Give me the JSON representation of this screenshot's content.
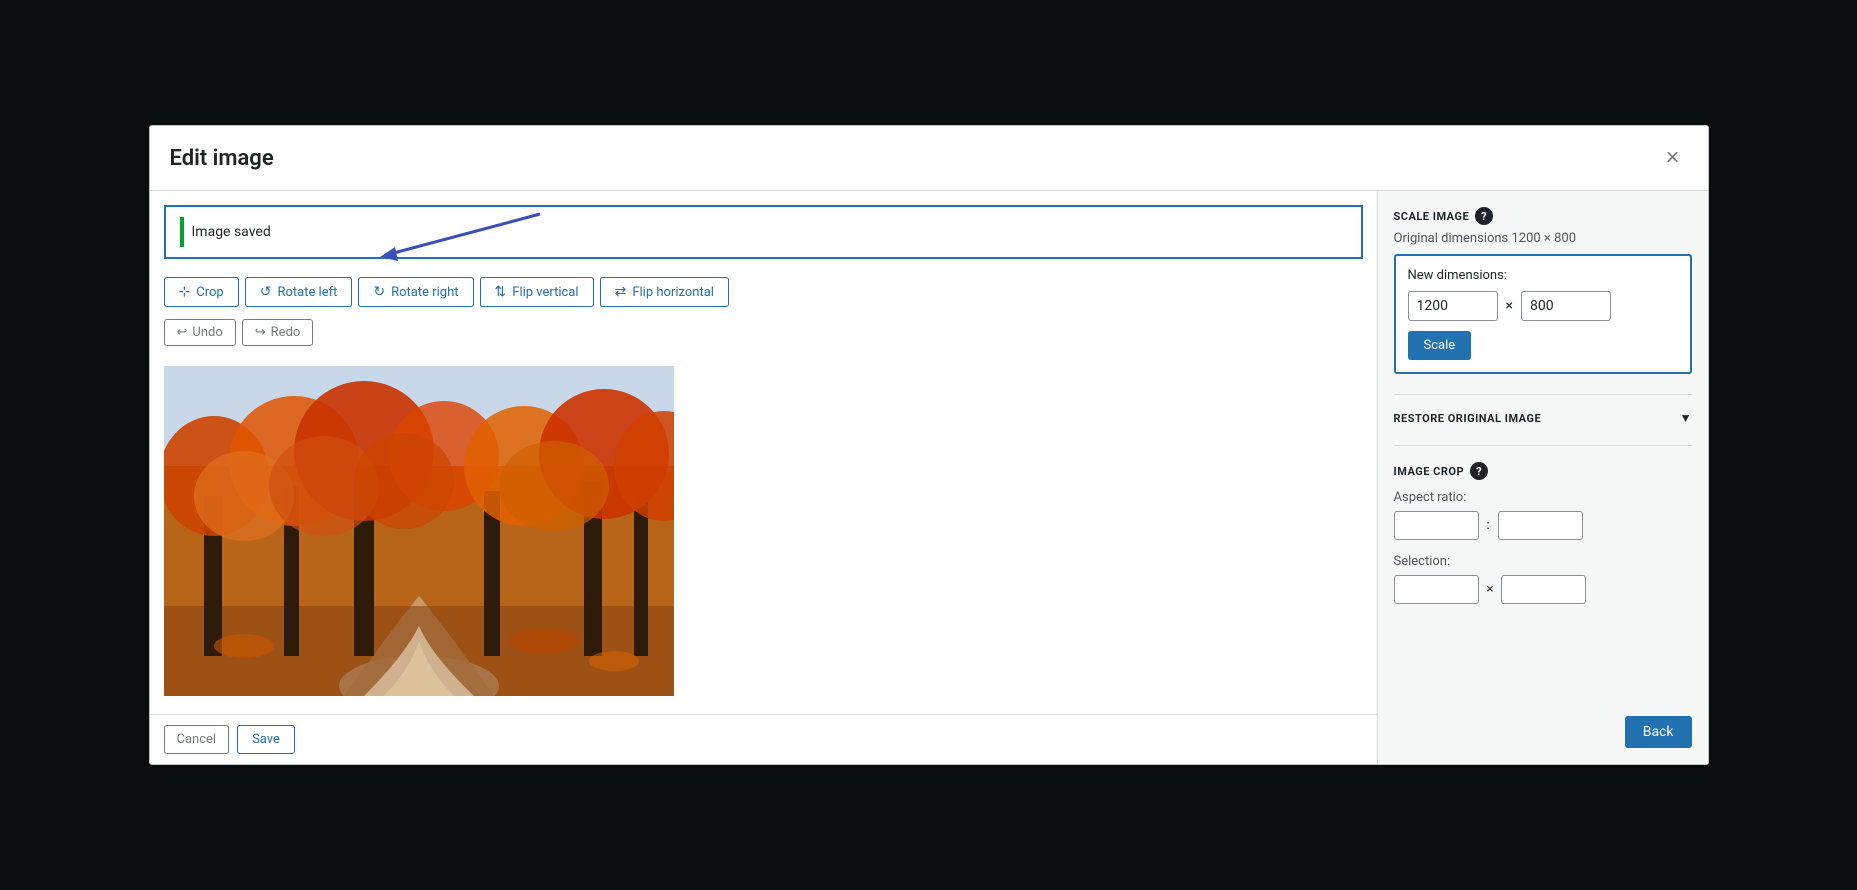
{
  "modal": {
    "title": "Edit image",
    "close_label": "×"
  },
  "notification": {
    "text": "Image saved"
  },
  "toolbar": {
    "crop_label": "Crop",
    "rotate_left_label": "Rotate left",
    "rotate_right_label": "Rotate right",
    "flip_vertical_label": "Flip vertical",
    "flip_horizontal_label": "Flip horizontal",
    "undo_label": "Undo",
    "redo_label": "Redo"
  },
  "footer": {
    "cancel_label": "Cancel",
    "save_label": "Save"
  },
  "sidebar": {
    "scale_image_title": "SCALE IMAGE",
    "original_dimensions": "Original dimensions 1200 × 800",
    "new_dimensions_label": "New dimensions:",
    "width_value": "1200",
    "height_value": "800",
    "scale_button_label": "Scale",
    "restore_title": "RESTORE ORIGINAL IMAGE",
    "image_crop_title": "IMAGE CROP",
    "aspect_ratio_label": "Aspect ratio:",
    "aspect_ratio_w": "",
    "aspect_ratio_h": "",
    "selection_label": "Selection:",
    "selection_w": "",
    "selection_h": "",
    "back_button_label": "Back"
  }
}
